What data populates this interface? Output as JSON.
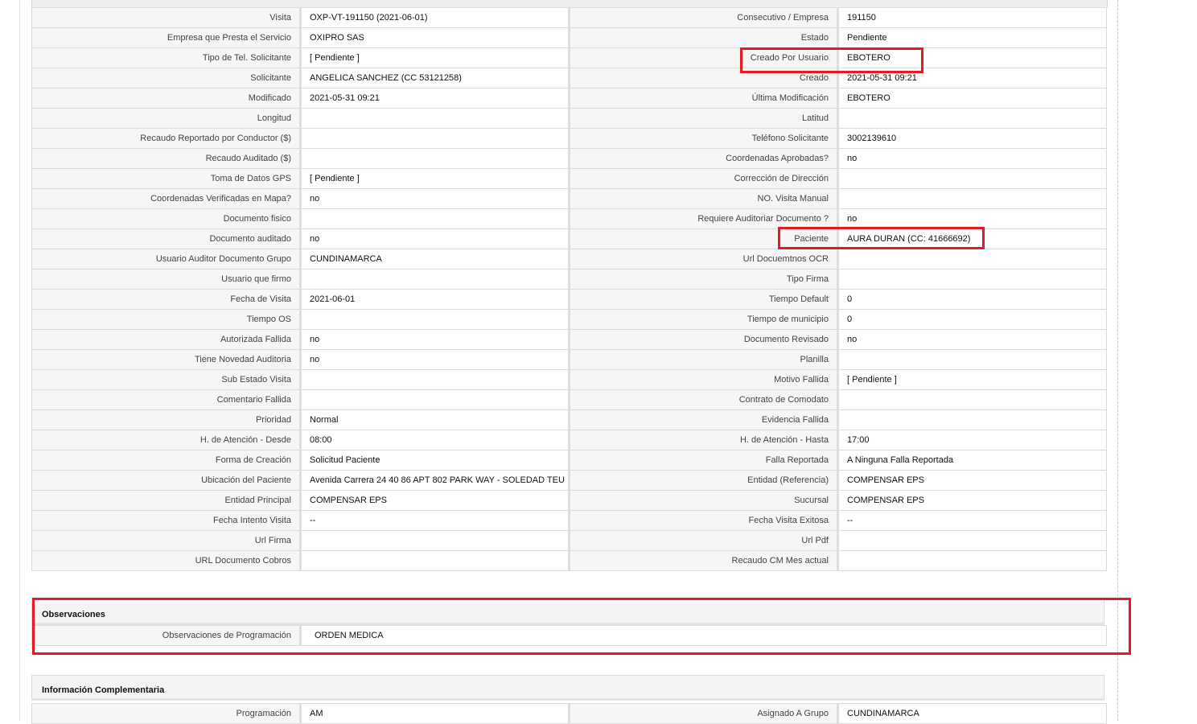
{
  "main_rows": [
    [
      "Visita",
      "OXP-VT-191150 (2021-06-01)",
      "Consecutivo / Empresa",
      "191150"
    ],
    [
      "Empresa que Presta el Servicio",
      "OXIPRO SAS",
      "Estado",
      "Pendiente"
    ],
    [
      "Tipo de Tel. Solicitante",
      "[ Pendiente ]",
      "Creado Por Usuario",
      "EBOTERO"
    ],
    [
      "Solicitante",
      "ANGELICA SANCHEZ (CC 53121258)",
      "Creado",
      "2021-05-31 09:21"
    ],
    [
      "Modificado",
      "2021-05-31 09:21",
      "Última Modificación",
      "EBOTERO"
    ],
    [
      "Longitud",
      "",
      "Latitud",
      ""
    ],
    [
      "Recaudo Reportado por Conductor ($)",
      "",
      "Teléfono Solicitante",
      "3002139610"
    ],
    [
      "Recaudo Auditado ($)",
      "",
      "Coordenadas Aprobadas?",
      "no"
    ],
    [
      "Toma de Datos GPS",
      "[ Pendiente ]",
      "Corrección de Dirección",
      ""
    ],
    [
      "Coordenadas Verificadas en Mapa?",
      "no",
      "NO. Visita Manual",
      ""
    ],
    [
      "Documento fisico",
      "",
      "Requiere Auditoriar Documento ?",
      "no"
    ],
    [
      "Documento auditado",
      "no",
      "Paciente",
      "AURA DURAN (CC: 41666692)"
    ],
    [
      "Usuario Auditor Documento Grupo",
      "CUNDINAMARCA",
      "Url Docuemtnos OCR",
      ""
    ],
    [
      "Usuario que firmo",
      "",
      "Tipo Firma",
      ""
    ],
    [
      "Fecha de Visita",
      "2021-06-01",
      "Tiempo Default",
      "0"
    ],
    [
      "Tiempo OS",
      "",
      "Tiempo de municipio",
      "0"
    ],
    [
      "Autorizada Fallida",
      "no",
      "Documento Revisado",
      "no"
    ],
    [
      "Tiene Novedad Auditoria",
      "no",
      "Planilla",
      ""
    ],
    [
      "Sub Estado Visita",
      "",
      "Motivo Fallida",
      "[ Pendiente ]"
    ],
    [
      "Comentario Fallida",
      "",
      "Contrato de Comodato",
      ""
    ],
    [
      "Prioridad",
      "Normal",
      "Evidencia Fallida",
      ""
    ],
    [
      "H. de Atención - Desde",
      "08:00",
      "H. de Atención - Hasta",
      "17:00"
    ],
    [
      "Forma de Creación",
      "Solicitud Paciente",
      "Falla Reportada",
      "A Ninguna Falla Reportada"
    ],
    [
      "Ubicación del Paciente",
      "Avenida Carrera 24 40 86 APT 802 PARK WAY - SOLEDAD TEU",
      "Entidad (Referencia)",
      "COMPENSAR EPS"
    ],
    [
      "Entidad Principal",
      "COMPENSAR EPS",
      "Sucursal",
      "COMPENSAR EPS"
    ],
    [
      "Fecha Intento Visita",
      "--",
      "Fecha Visita Exitosa",
      "--"
    ],
    [
      "Url Firma",
      "",
      "Url Pdf",
      ""
    ],
    [
      "URL Documento Cobros",
      "",
      "Recaudo CM Mes actual",
      ""
    ]
  ],
  "observaciones": {
    "title": "Observaciones",
    "label": "Observaciones de Programación",
    "value": "ORDEN MEDICA"
  },
  "complementaria": {
    "title": "Información Complementaria",
    "row": [
      "Programación",
      "AM",
      "Asignado A Grupo",
      "CUNDINAMARCA"
    ]
  },
  "highlight_color": "#e41b23"
}
